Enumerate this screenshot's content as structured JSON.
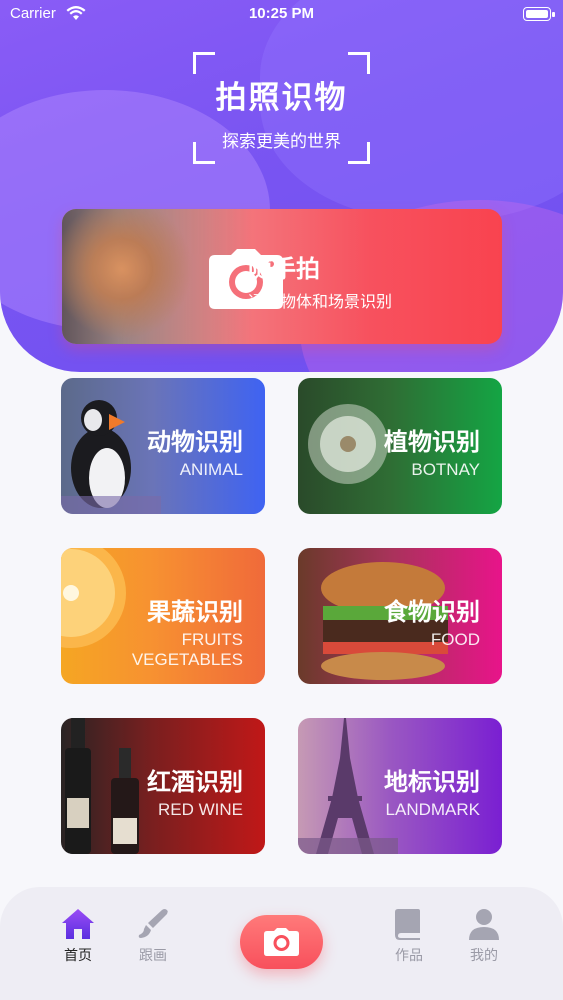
{
  "status_bar": {
    "carrier": "Carrier",
    "time": "10:25 PM"
  },
  "hero": {
    "title": "拍照识物",
    "subtitle": "探索更美的世界"
  },
  "quick_shot": {
    "title": "随手拍",
    "subtitle": "通用物体和场景识别"
  },
  "categories": [
    {
      "title": "动物识别",
      "en": "ANIMAL"
    },
    {
      "title": "植物识别",
      "en": "BOTNAY"
    },
    {
      "title": "果蔬识别",
      "en_line1": "FRUITS",
      "en_line2": "VEGETABLES"
    },
    {
      "title": "食物识别",
      "en": "FOOD"
    },
    {
      "title": "红酒识别",
      "en": "RED WINE"
    },
    {
      "title": "地标识别",
      "en": "LANDMARK"
    }
  ],
  "tabbar": {
    "home": "首页",
    "trace": "跟画",
    "works": "作品",
    "mine": "我的"
  },
  "colors": {
    "accent": "#6d4ff0",
    "fab": "#f8505c",
    "quick_shot": "#f9434f"
  }
}
